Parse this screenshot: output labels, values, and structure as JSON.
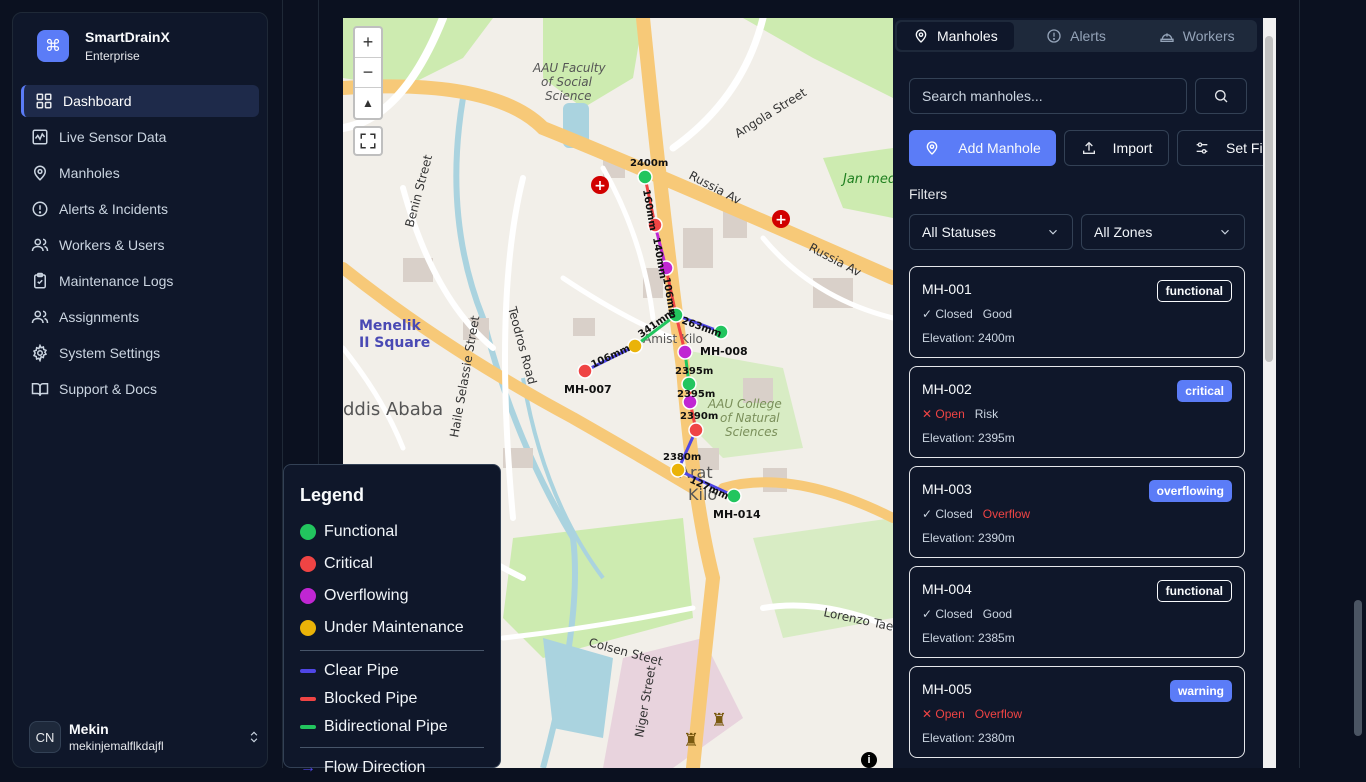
{
  "brand": {
    "title": "SmartDrainX",
    "subtitle": "Enterprise",
    "logo_icon": "command-icon",
    "accent": "#5b7cf7"
  },
  "nav": [
    {
      "label": "Dashboard",
      "icon": "grid-icon",
      "active": true
    },
    {
      "label": "Live Sensor Data",
      "icon": "activity-icon"
    },
    {
      "label": "Manholes",
      "icon": "map-pin-icon"
    },
    {
      "label": "Alerts & Incidents",
      "icon": "alert-circle-icon"
    },
    {
      "label": "Workers & Users",
      "icon": "users-icon"
    },
    {
      "label": "Maintenance Logs",
      "icon": "clipboard-icon"
    },
    {
      "label": "Assignments",
      "icon": "user-check-icon"
    },
    {
      "label": "System Settings",
      "icon": "gear-icon"
    },
    {
      "label": "Support & Docs",
      "icon": "book-icon"
    }
  ],
  "user": {
    "initials": "CN",
    "name": "Mekin",
    "email": "mekinjemalflkdajfl"
  },
  "map": {
    "zoom_in": "+",
    "zoom_out": "−",
    "reset": "▲",
    "info": "i",
    "places": [
      "AAU Faculty of Social Science",
      "Menelik II Square",
      "AAU College of Natural Sciences",
      "Amist Kilo",
      "Arat Kilo",
      "Russia Av",
      "Angola Street",
      "Benin Street",
      "Haile Selassie Street",
      "Teodros Road",
      "Lorenzo Taezaz",
      "Colsen Steet",
      "Niger Street"
    ],
    "manholes": [
      {
        "id": "MH-007",
        "status": "critical"
      },
      {
        "id": "MH-008",
        "status": "functional"
      },
      {
        "id": "MH-014",
        "status": "functional"
      }
    ],
    "elevation_labels": [
      "2400m",
      "2395m",
      "2395m",
      "2390m",
      "2380m"
    ],
    "pipe_labels": [
      "160mm",
      "140mm",
      "106mm",
      "263mm",
      "341mm",
      "106mm",
      "127mm"
    ]
  },
  "legend": {
    "title": "Legend",
    "statuses": [
      {
        "label": "Functional",
        "color": "#22c55e"
      },
      {
        "label": "Critical",
        "color": "#ef4444"
      },
      {
        "label": "Overflowing",
        "color": "#c026d3"
      },
      {
        "label": "Under Maintenance",
        "color": "#eab308"
      }
    ],
    "pipes": [
      {
        "label": "Clear Pipe",
        "color": "#4f46e5"
      },
      {
        "label": "Blocked Pipe",
        "color": "#ef4444"
      },
      {
        "label": "Bidirectional Pipe",
        "color": "#22c55e"
      }
    ],
    "flow_label": "Flow Direction"
  },
  "panel": {
    "tabs": [
      {
        "label": "Manholes",
        "icon": "map-pin-icon",
        "active": true
      },
      {
        "label": "Alerts",
        "icon": "alert-circle-icon"
      },
      {
        "label": "Workers",
        "icon": "hard-hat-icon"
      }
    ],
    "search_placeholder": "Search manholes...",
    "buttons": {
      "add": "Add Manhole",
      "import": "Import",
      "set": "Set Fi"
    },
    "filters_title": "Filters",
    "status_filter": "All Statuses",
    "zone_filter": "All Zones",
    "cards": [
      {
        "id": "MH-001",
        "badge": "functional",
        "badge_style": "outline",
        "cover": "✓ Closed",
        "cover_bad": false,
        "condition": "Good",
        "condition_bad": false,
        "elevation": "Elevation: 2400m"
      },
      {
        "id": "MH-002",
        "badge": "critical",
        "badge_style": "filled",
        "cover": "✕ Open",
        "cover_bad": true,
        "condition": "Risk",
        "condition_bad": false,
        "elevation": "Elevation: 2395m"
      },
      {
        "id": "MH-003",
        "badge": "overflowing",
        "badge_style": "filled",
        "cover": "✓ Closed",
        "cover_bad": false,
        "condition": "Overflow",
        "condition_bad": true,
        "elevation": "Elevation: 2390m"
      },
      {
        "id": "MH-004",
        "badge": "functional",
        "badge_style": "outline",
        "cover": "✓ Closed",
        "cover_bad": false,
        "condition": "Good",
        "condition_bad": false,
        "elevation": "Elevation: 2385m"
      },
      {
        "id": "MH-005",
        "badge": "warning",
        "badge_style": "filled",
        "cover": "✕ Open",
        "cover_bad": true,
        "condition": "Overflow",
        "condition_bad": true,
        "elevation": "Elevation: 2380m"
      }
    ]
  }
}
